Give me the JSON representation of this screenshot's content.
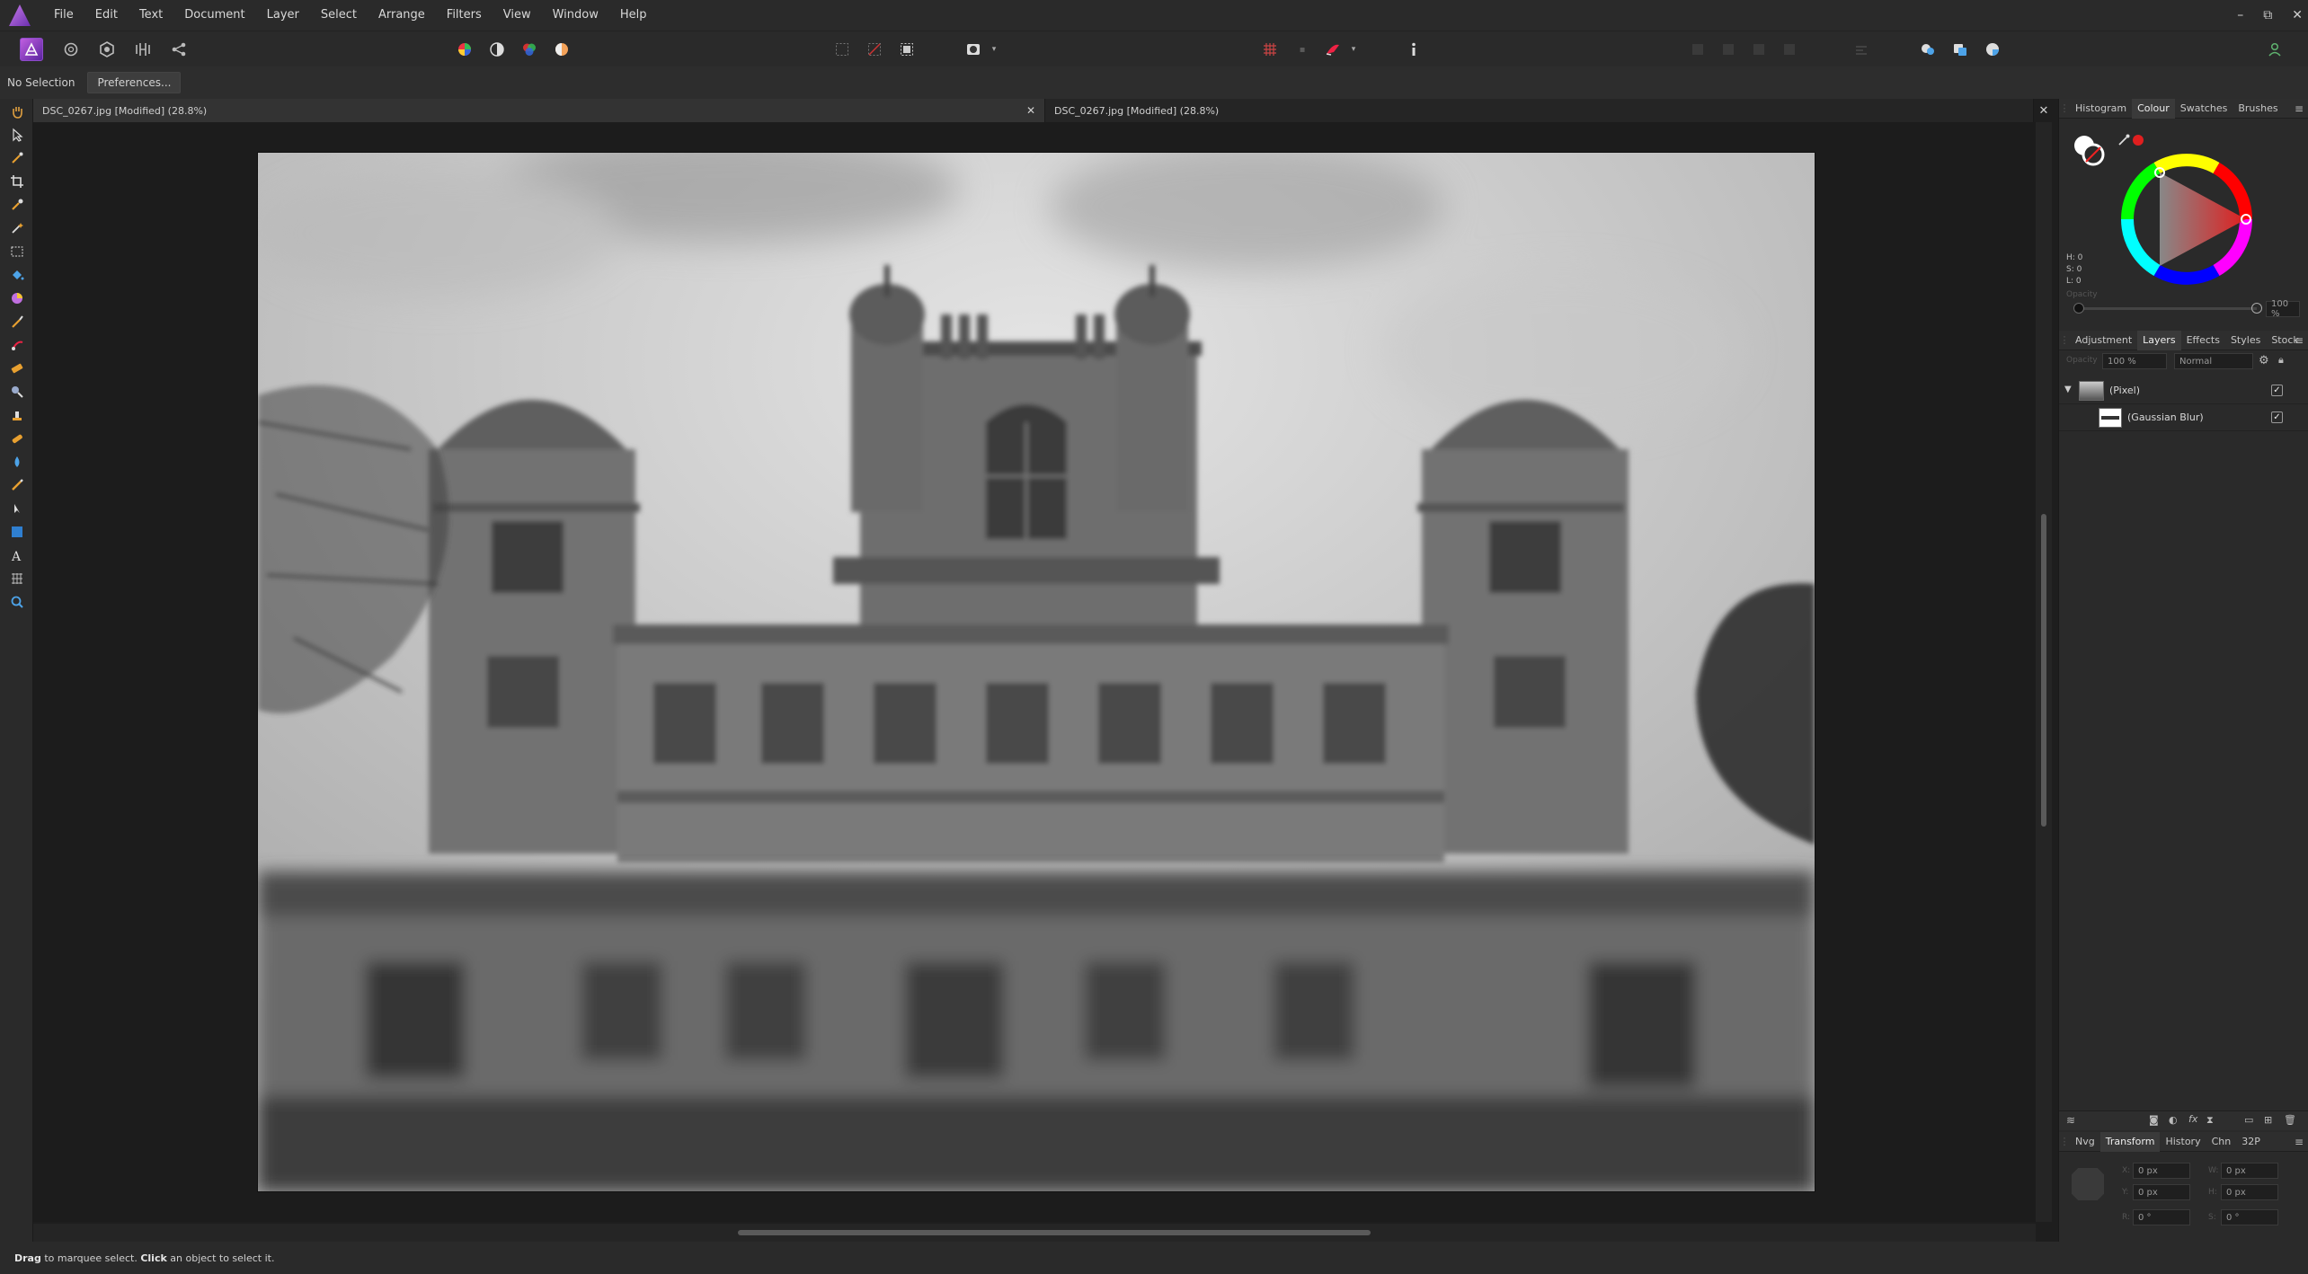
{
  "menu": [
    "File",
    "Edit",
    "Text",
    "Document",
    "Layer",
    "Select",
    "Arrange",
    "Filters",
    "View",
    "Window",
    "Help"
  ],
  "window_controls": {
    "minimize": "–",
    "restore": "⧉",
    "close": "✕"
  },
  "context": {
    "selection": "No Selection",
    "preferences": "Preferences..."
  },
  "tabs": [
    {
      "title": "DSC_0267.jpg [Modified] (28.8%)",
      "close": "✕"
    },
    {
      "title": "DSC_0267.jpg [Modified] (28.8%)"
    }
  ],
  "canvas_close": "✕",
  "colour_panel": {
    "tabs": [
      "Histogram",
      "Colour",
      "Swatches",
      "Brushes"
    ],
    "active": "Colour",
    "hsl": {
      "h": "H: 0",
      "s": "S: 0",
      "l": "L: 0"
    },
    "opacity_label": "Opacity",
    "opacity_value": "100 %"
  },
  "layers_panel": {
    "tabs": [
      "Adjustment",
      "Layers",
      "Effects",
      "Styles",
      "Stock"
    ],
    "active": "Layers",
    "opacity_label": "Opacity",
    "opacity_value": "100 %",
    "blend_mode": "Normal",
    "layers": [
      {
        "name": "(Pixel)",
        "visible": "✓"
      },
      {
        "name": "(Gaussian Blur)",
        "visible": "✓"
      }
    ]
  },
  "transform_panel": {
    "tabs": [
      "Nvg",
      "Transform",
      "History",
      "Chn",
      "32P"
    ],
    "active": "Transform",
    "fields": {
      "x": "0 px",
      "y": "0 px",
      "w": "0 px",
      "h": "0 px",
      "r": "0 °",
      "s": "0 °"
    },
    "labels": {
      "x": "X:",
      "y": "Y:",
      "w": "W:",
      "h": "H:",
      "r": "R:",
      "s": "S:"
    }
  },
  "status": {
    "drag": "Drag",
    "mid": " to marquee select. ",
    "click": "Click",
    "end": " an object to select it."
  },
  "colors": {
    "accent": "#8c4bc8",
    "panel": "#2a2a2a",
    "canvas": "#1c1c1c",
    "brush_red": "#e01f1f"
  }
}
